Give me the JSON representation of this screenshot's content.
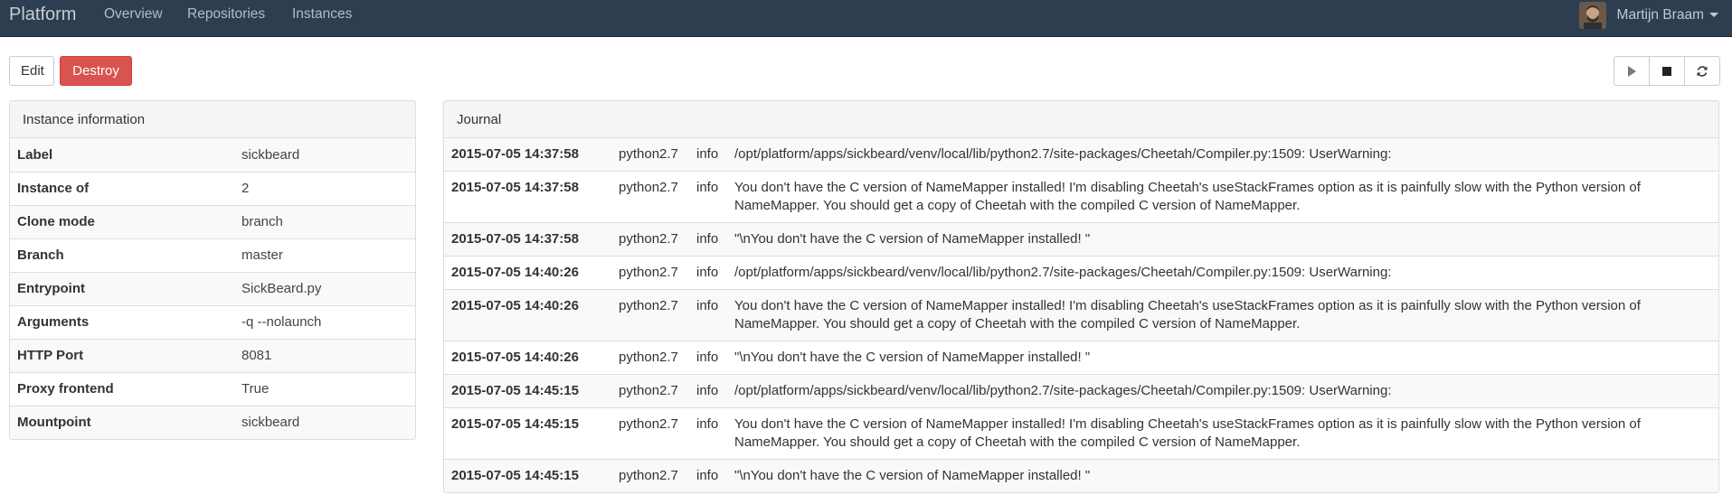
{
  "navbar": {
    "brand": "Platform",
    "links": [
      "Overview",
      "Repositories",
      "Instances"
    ],
    "user_name": "Martijn Braam"
  },
  "actions": {
    "edit_label": "Edit",
    "destroy_label": "Destroy",
    "controls": [
      "play-icon",
      "stop-icon",
      "refresh-icon"
    ]
  },
  "info_panel": {
    "title": "Instance information",
    "rows": [
      {
        "key": "Label",
        "value": "sickbeard"
      },
      {
        "key": "Instance of",
        "value": "2"
      },
      {
        "key": "Clone mode",
        "value": "branch"
      },
      {
        "key": "Branch",
        "value": "master"
      },
      {
        "key": "Entrypoint",
        "value": "SickBeard.py"
      },
      {
        "key": "Arguments",
        "value": "-q --nolaunch"
      },
      {
        "key": "HTTP Port",
        "value": "8081"
      },
      {
        "key": "Proxy frontend",
        "value": "True"
      },
      {
        "key": "Mountpoint",
        "value": "sickbeard"
      }
    ]
  },
  "journal": {
    "title": "Journal",
    "entries": [
      {
        "time": "2015-07-05 14:37:58",
        "process": "python2.7",
        "level": "info",
        "message": "/opt/platform/apps/sickbeard/venv/local/lib/python2.7/site-packages/Cheetah/Compiler.py:1509: UserWarning:"
      },
      {
        "time": "2015-07-05 14:37:58",
        "process": "python2.7",
        "level": "info",
        "message": "You don't have the C version of NameMapper installed! I'm disabling Cheetah's useStackFrames option as it is painfully slow with the Python version of NameMapper. You should get a copy of Cheetah with the compiled C version of NameMapper."
      },
      {
        "time": "2015-07-05 14:37:58",
        "process": "python2.7",
        "level": "info",
        "message": "\"\\nYou don't have the C version of NameMapper installed! \""
      },
      {
        "time": "2015-07-05 14:40:26",
        "process": "python2.7",
        "level": "info",
        "message": "/opt/platform/apps/sickbeard/venv/local/lib/python2.7/site-packages/Cheetah/Compiler.py:1509: UserWarning:"
      },
      {
        "time": "2015-07-05 14:40:26",
        "process": "python2.7",
        "level": "info",
        "message": "You don't have the C version of NameMapper installed! I'm disabling Cheetah's useStackFrames option as it is painfully slow with the Python version of NameMapper. You should get a copy of Cheetah with the compiled C version of NameMapper."
      },
      {
        "time": "2015-07-05 14:40:26",
        "process": "python2.7",
        "level": "info",
        "message": "\"\\nYou don't have the C version of NameMapper installed! \""
      },
      {
        "time": "2015-07-05 14:45:15",
        "process": "python2.7",
        "level": "info",
        "message": "/opt/platform/apps/sickbeard/venv/local/lib/python2.7/site-packages/Cheetah/Compiler.py:1509: UserWarning:"
      },
      {
        "time": "2015-07-05 14:45:15",
        "process": "python2.7",
        "level": "info",
        "message": "You don't have the C version of NameMapper installed! I'm disabling Cheetah's useStackFrames option as it is painfully slow with the Python version of NameMapper. You should get a copy of Cheetah with the compiled C version of NameMapper."
      },
      {
        "time": "2015-07-05 14:45:15",
        "process": "python2.7",
        "level": "info",
        "message": "\"\\nYou don't have the C version of NameMapper installed! \""
      }
    ]
  }
}
